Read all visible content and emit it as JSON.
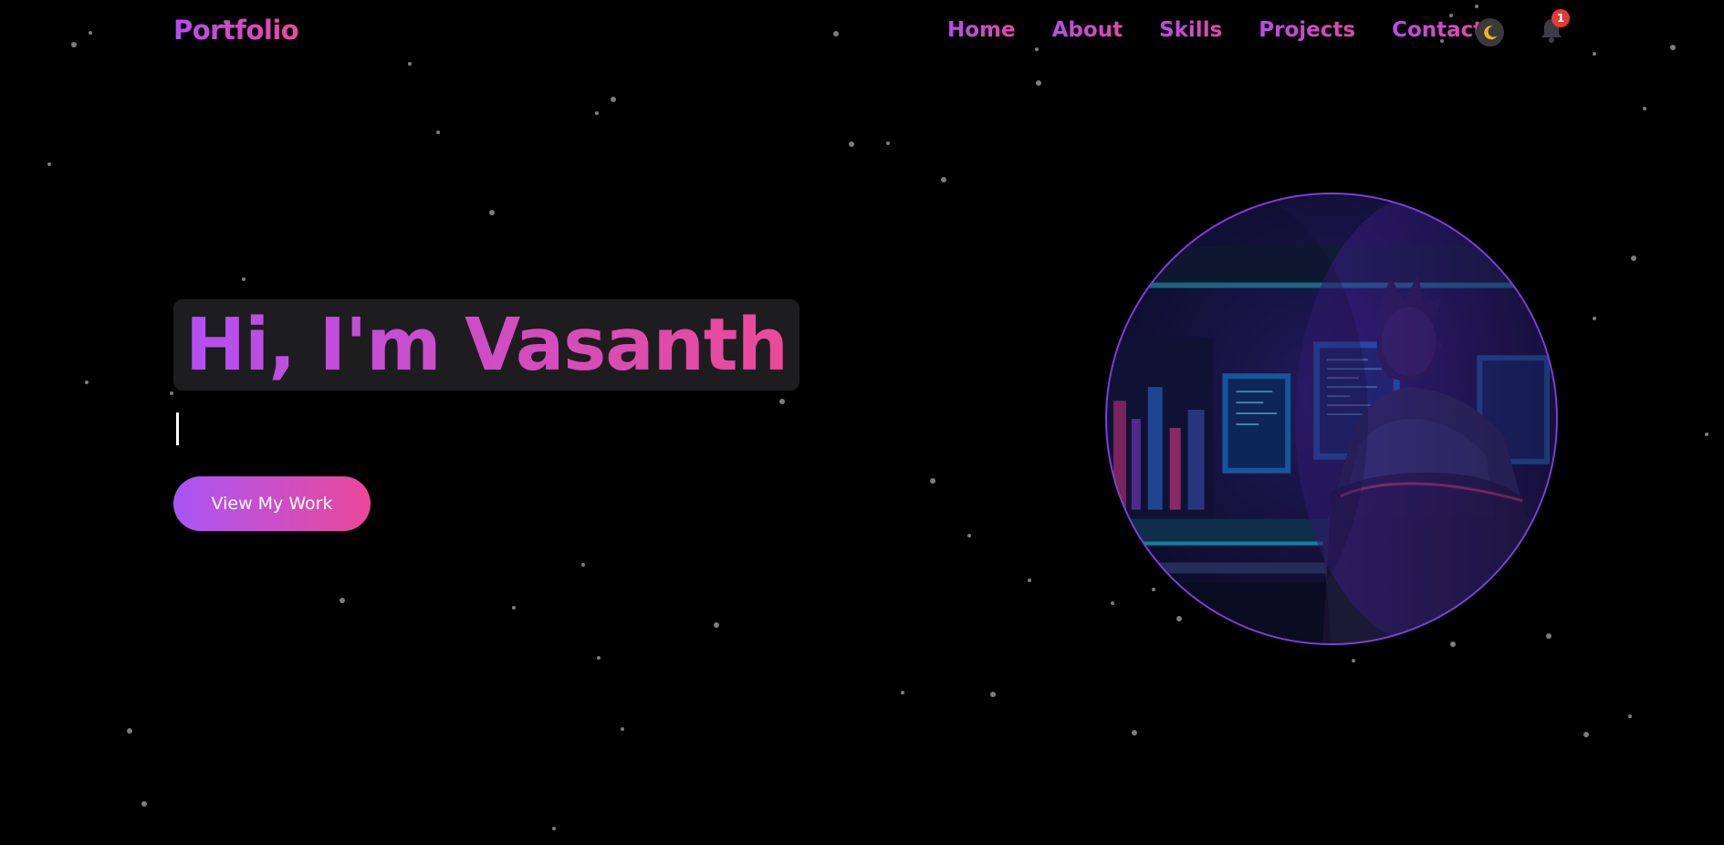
{
  "nav": {
    "brand": "Portfolio",
    "links": [
      "Home",
      "About",
      "Skills",
      "Projects",
      "Contact"
    ],
    "notification_count": "1",
    "theme_icon": "moon-icon",
    "bell_icon": "bell-icon"
  },
  "hero": {
    "title": "Hi, I'm Vasanth",
    "cta_label": "View My Work"
  },
  "colors": {
    "background": "#000000",
    "gradient_start": "#a855f7",
    "gradient_end": "#ec4899",
    "badge": "#e53935",
    "moon": "#f2b51c"
  }
}
